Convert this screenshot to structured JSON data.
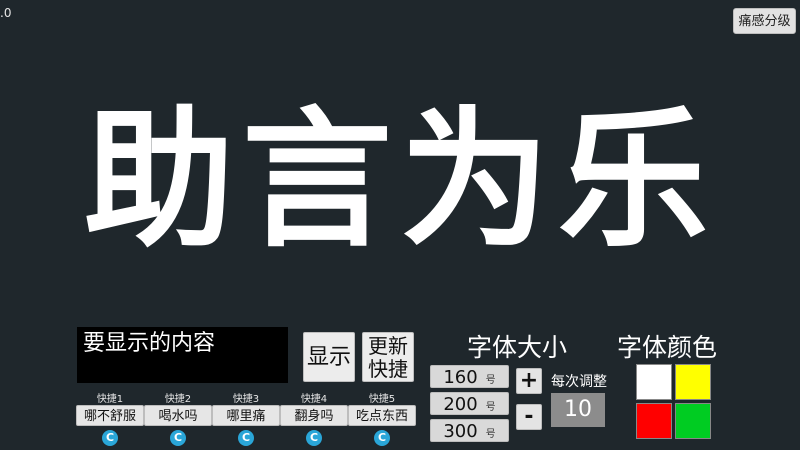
{
  "corner_text": ".0",
  "pain_grade_button": "痛感分级",
  "display_text": "助言为乐",
  "content_input_placeholder": "要显示的内容",
  "show_button": "显示",
  "update_quick_button": "更新\n快捷",
  "quick_items": [
    {
      "label": "快捷1",
      "text": "哪不舒服"
    },
    {
      "label": "快捷2",
      "text": "喝水吗"
    },
    {
      "label": "快捷3",
      "text": "哪里痛"
    },
    {
      "label": "快捷4",
      "text": "翻身吗"
    },
    {
      "label": "快捷5",
      "text": "吃点东西"
    }
  ],
  "refresh_glyph": "C",
  "font_size": {
    "title": "字体大小",
    "presets": [
      {
        "value": "160",
        "unit": "号"
      },
      {
        "value": "200",
        "unit": "号"
      },
      {
        "value": "300",
        "unit": "号"
      }
    ],
    "plus_label": "+",
    "minus_label": "-",
    "step_label": "每次调整",
    "step_value": "10"
  },
  "font_color": {
    "title": "字体颜色",
    "swatches": [
      "#ffffff",
      "#ffff00",
      "#ff0000",
      "#00cc22"
    ]
  },
  "colors": {
    "background": "#1f272c",
    "display_text": "#ffffff",
    "icon_accent": "#2aa6d8"
  }
}
